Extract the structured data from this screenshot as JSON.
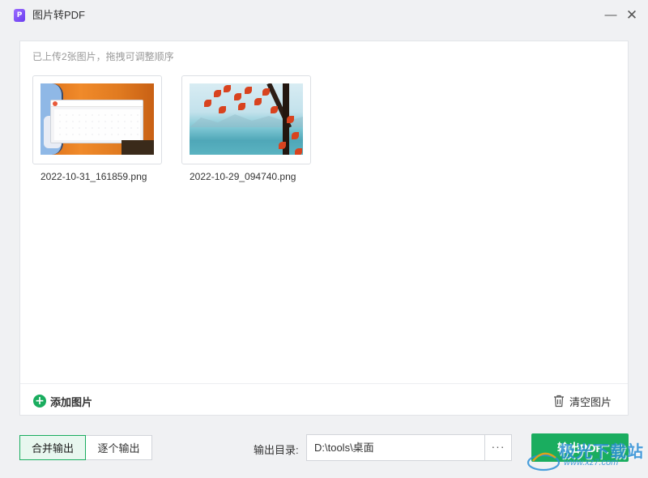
{
  "window": {
    "title": "图片转PDF",
    "app_icon_letter": "P",
    "minimize_glyph": "—",
    "close_glyph": "✕"
  },
  "panel": {
    "hint": "已上传2张图片，拖拽可调整顺序",
    "images": [
      {
        "filename": "2022-10-31_161859.png"
      },
      {
        "filename": "2022-10-29_094740.png"
      }
    ],
    "add_label": "添加图片",
    "clear_label": "清空图片"
  },
  "bottom": {
    "merge_label": "合并输出",
    "single_label": "逐个输出",
    "active_mode": "merge",
    "output_dir_label": "输出目录:",
    "output_dir_value": "D:\\tools\\桌面",
    "browse_label": "···",
    "export_label": "输出PDF"
  },
  "watermark": {
    "text": "极光下载站",
    "url": "www.xz7.com"
  },
  "icons": {
    "app": "pdf-app-icon",
    "add": "plus-circle-icon",
    "clear": "trash-icon",
    "minimize": "minimize-icon",
    "close": "close-icon"
  },
  "colors": {
    "accent": "#1aad5f",
    "app_icon": "#7b4df5",
    "background": "#f0f1f3"
  }
}
